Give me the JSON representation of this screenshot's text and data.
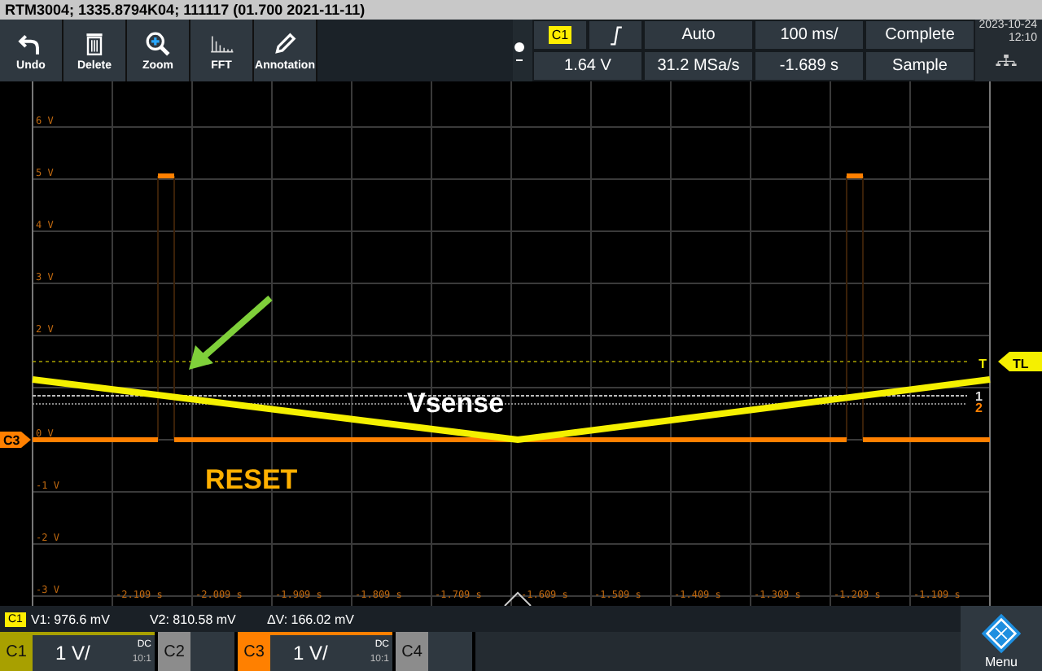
{
  "window": {
    "title": "RTM3004; 1335.8794K04; 111117 (01.700 2021-11-11)"
  },
  "toolbar": [
    {
      "label": "Undo",
      "kind": "undo"
    },
    {
      "label": "Delete",
      "kind": "delete"
    },
    {
      "label": "Zoom",
      "kind": "zoom"
    },
    {
      "label": "FFT",
      "kind": "fft"
    },
    {
      "label": "Annotation",
      "kind": "annotation"
    }
  ],
  "trigger": {
    "source": "C1",
    "level": "1.64 V",
    "mode": "Auto",
    "sample_rate": "31.2 MSa/s",
    "timebase": "100 ms/",
    "position": "-1.689 s",
    "acquisition": "Complete",
    "acq_mode": "Sample"
  },
  "clock": {
    "date": "2023-10-24",
    "time": "12:10"
  },
  "y_labels": [
    "6 V",
    "5 V",
    "4 V",
    "3 V",
    "2 V",
    "0 V",
    "-1 V",
    "-2 V",
    "-3 V"
  ],
  "x_labels": [
    "-2.109 s",
    "-2.009 s",
    "-1.909 s",
    "-1.809 s",
    "-1.709 s",
    "-1.609 s",
    "-1.509 s",
    "-1.409 s",
    "-1.309 s",
    "-1.209 s",
    "-1.109 s"
  ],
  "markers": {
    "channel": "C3",
    "trigger": "T",
    "trigger_level": "TL",
    "cursor_1": "1",
    "cursor_2": "2"
  },
  "annotations": [
    {
      "text": "Vsense",
      "kind": "vsense"
    },
    {
      "text": "RESET",
      "kind": "reset"
    }
  ],
  "measurement": {
    "source": "C1",
    "v1": "V1: 976.6 mV",
    "v2": "V2: 810.58 mV",
    "dv": "ΔV: 166.02 mV"
  },
  "channels": [
    {
      "label": "C1",
      "active": true,
      "color": "#a8a000",
      "scale": "1 V/",
      "coupling": "DC",
      "probe": "10:1"
    },
    {
      "label": "C2",
      "active": false,
      "color": "#8c8c8c"
    },
    {
      "label": "C3",
      "active": true,
      "color": "#ff8000",
      "scale": "1 V/",
      "coupling": "DC",
      "probe": "10:1"
    },
    {
      "label": "C4",
      "active": false,
      "color": "#8c8c8c"
    }
  ],
  "menu": {
    "label": "Menu"
  }
}
